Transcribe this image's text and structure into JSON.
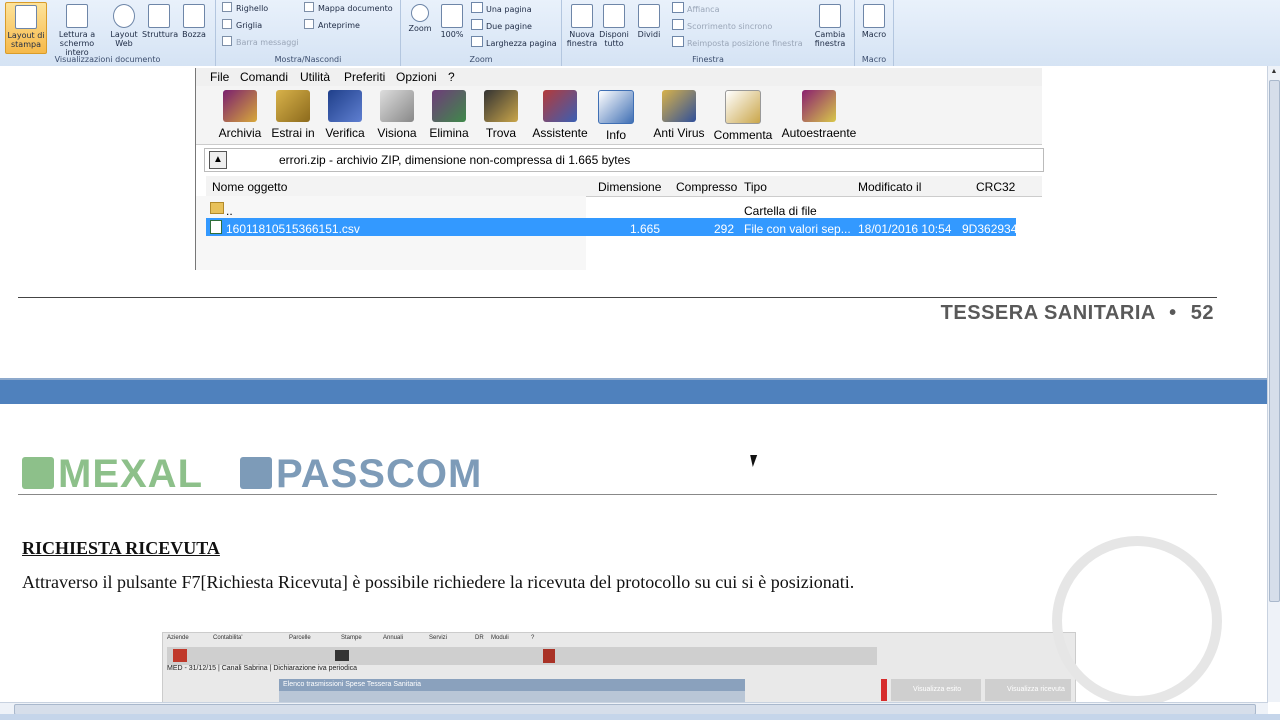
{
  "ribbon": {
    "groups": [
      {
        "label": "Visualizzazioni documento"
      },
      {
        "label": "Mostra/Nascondi"
      },
      {
        "label": "Zoom"
      },
      {
        "label": "Finestra"
      },
      {
        "label": "Macro"
      }
    ],
    "views": [
      "Layout di stampa",
      "Lettura a schermo intero",
      "Layout Web",
      "Struttura",
      "Bozza"
    ],
    "show_hide": [
      {
        "label": "Righello",
        "checked": false
      },
      {
        "label": "Griglia",
        "checked": false
      },
      {
        "label": "Barra messaggi",
        "checked": false,
        "disabled": true
      },
      {
        "label": "Mappa documento",
        "checked": false
      },
      {
        "label": "Anteprime",
        "checked": false
      }
    ],
    "zoom": {
      "zoom_label": "Zoom",
      "pct_label": "100%",
      "one_page": "Una pagina",
      "two_pages": "Due pagine",
      "page_width": "Larghezza pagina"
    },
    "window": {
      "new": "Nuova finestra",
      "arrange": "Disponi tutto",
      "split": "Dividi",
      "side": "Affianca",
      "sync": "Scorrimento sincrono",
      "reset": "Reimposta posizione finestra",
      "switch": "Cambia finestra"
    },
    "macro": {
      "label": "Macro"
    }
  },
  "rar": {
    "menu": [
      "File",
      "Comandi",
      "Utilità",
      "Preferiti",
      "Opzioni",
      "?"
    ],
    "tools": [
      "Archivia",
      "Estrai in",
      "Verifica",
      "Visiona",
      "Elimina",
      "Trova",
      "Assistente",
      "Info",
      "Anti Virus",
      "Commenta",
      "Autoestraente"
    ],
    "path": "errori.zip - archivio ZIP, dimensione non-compressa di 1.665 bytes",
    "columns": [
      "Nome oggetto",
      "Dimensione",
      "Compresso",
      "Tipo",
      "Modificato il",
      "CRC32"
    ],
    "rows": [
      {
        "name": "..",
        "size": "",
        "packed": "",
        "type": "Cartella di file",
        "modified": "",
        "crc": ""
      },
      {
        "name": "16011810515366151.csv",
        "size": "1.665",
        "packed": "292",
        "type": "File con valori sep...",
        "modified": "18/01/2016 10:54",
        "crc": "9D362934"
      }
    ]
  },
  "page1": {
    "footer": "TESSERA SANITARIA",
    "bullet": "•",
    "page": "52"
  },
  "page2": {
    "logo1": "MEXAL",
    "logo2": "PASSCOM",
    "heading": "RICHIESTA RICEVUTA",
    "paragraph": "Attraverso il pulsante F7[Richiesta Ricevuta] è possibile richiedere la ricevuta del protocollo su cui si è posizionati.",
    "shot": {
      "menu": [
        "Aziende",
        "Contabilita'",
        "Parcelle",
        "Stampe",
        "Annuali",
        "Servizi",
        "DR",
        "Moduli",
        "?"
      ],
      "status": "MED - 31/12/15 | Canali Sabrina | Dichiarazione iva periodica",
      "window_title": "Elenco trasmissioni Spese Tessera Sanitaria",
      "btn_f6": "Visualizza esito",
      "btn_f7": "Visualizza ricevuta"
    }
  },
  "colors": {
    "accent": "#4f81bd",
    "selection": "#3399ff",
    "mexal": "#8dc08a",
    "passcom": "#7d9bb8"
  }
}
